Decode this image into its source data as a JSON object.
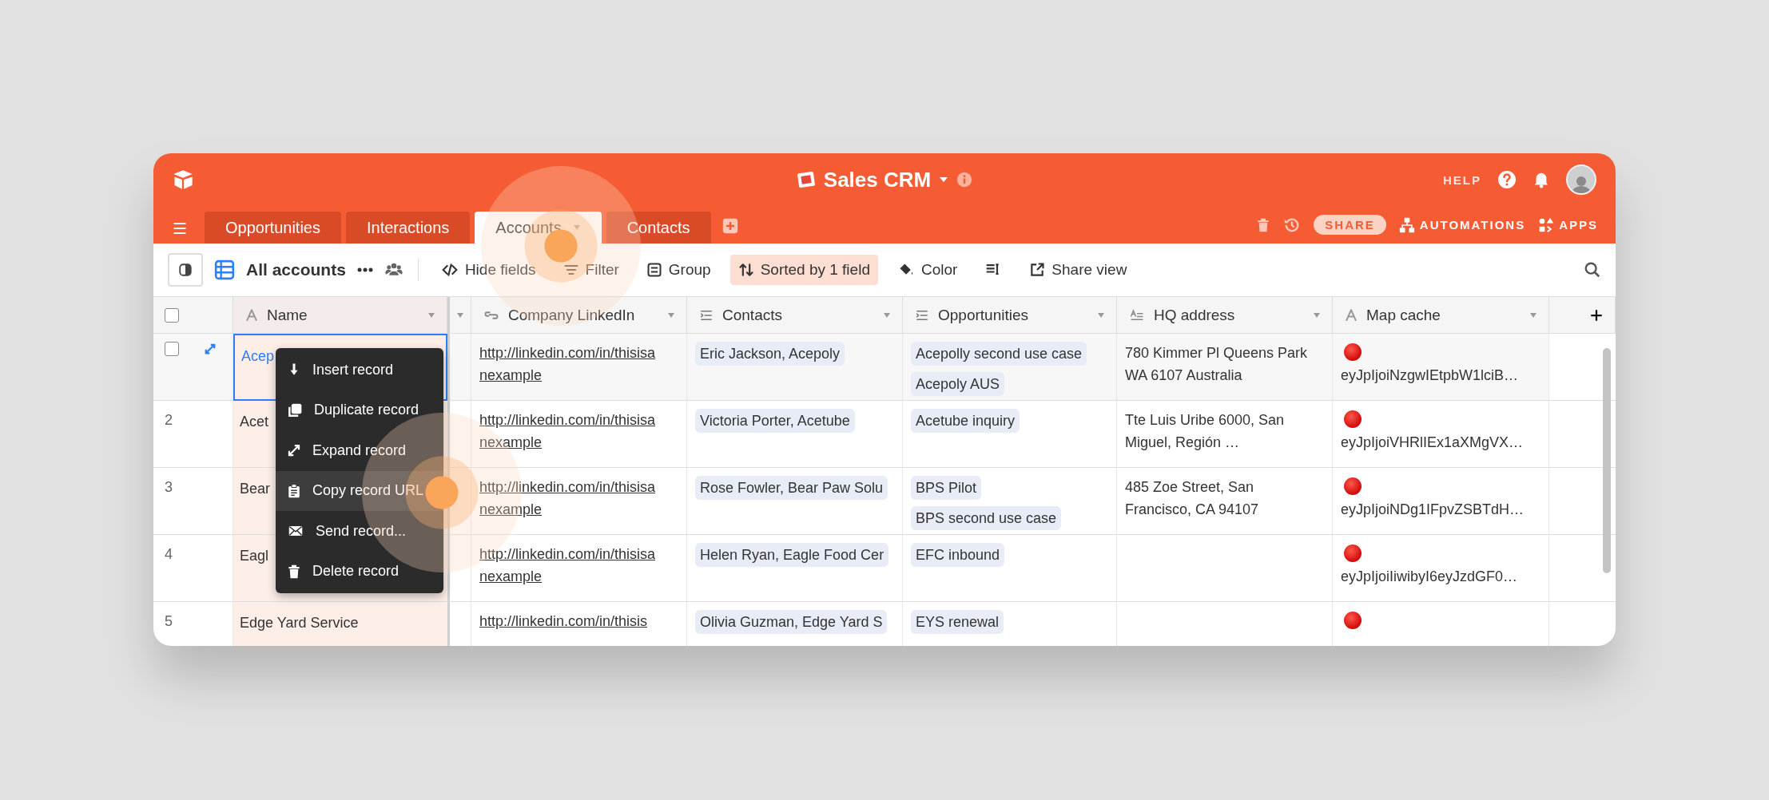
{
  "app": {
    "title": "Sales CRM",
    "help": "HELP"
  },
  "tabs": [
    {
      "label": "Opportunities",
      "selected": false
    },
    {
      "label": "Interactions",
      "selected": false
    },
    {
      "label": "Accounts",
      "selected": true
    },
    {
      "label": "Contacts",
      "selected": false
    }
  ],
  "header_actions": {
    "share": "SHARE",
    "automations": "AUTOMATIONS",
    "apps": "APPS"
  },
  "toolbar": {
    "view_name": "All accounts",
    "buttons": [
      {
        "label": "Hide fields",
        "kind": "hide",
        "active": false
      },
      {
        "label": "Filter",
        "kind": "filter",
        "active": false
      },
      {
        "label": "Group",
        "kind": "group",
        "active": false
      },
      {
        "label": "Sorted by 1 field",
        "kind": "sort",
        "active": true
      },
      {
        "label": "Color",
        "kind": "color",
        "active": false
      },
      {
        "kind": "row-height",
        "active": false
      },
      {
        "label": "Share view",
        "kind": "share",
        "active": false
      }
    ]
  },
  "table": {
    "select_all": {
      "checked": false
    },
    "columns": [
      {
        "label": "Name",
        "kind": "text"
      },
      {
        "kind": "cut"
      },
      {
        "label": "Company LinkedIn",
        "kind": "link"
      },
      {
        "label": "Contacts",
        "kind": "linked"
      },
      {
        "label": "Opportunities",
        "kind": "linked"
      },
      {
        "label": "HQ address",
        "kind": "longtext"
      },
      {
        "label": "Map cache",
        "kind": "text"
      }
    ],
    "rows": [
      {
        "hovered": true,
        "checked": false,
        "selected": true,
        "name": "Acep",
        "linkedin": "http://linkedin.com/in/thisisanexample",
        "contacts": [
          "Eric Jackson, Acepoly"
        ],
        "opportunities": [
          "Acepolly second use case",
          "Acepoly AUS"
        ],
        "hq_address": "780 Kimmer Pl Queens Park WA 6107 Australia",
        "map_cache": "eyJpIjoiNzgwIEtpbW1lciB…"
      },
      {
        "number": "2",
        "hovered": false,
        "selected": false,
        "name": "Acet",
        "linkedin": "http://linkedin.com/in/thisisanexample",
        "contacts": [
          "Victoria Porter, Acetube"
        ],
        "opportunities": [
          "Acetube inquiry"
        ],
        "hq_address": "Tte Luis Uribe 6000, San Miguel, Región …",
        "map_cache": "eyJpIjoiVHRlIEx1aXMgVX…"
      },
      {
        "number": "3",
        "hovered": false,
        "selected": false,
        "name": "Bear",
        "linkedin": "http://linkedin.com/in/thisisanexample",
        "contacts": [
          "Rose Fowler, Bear Paw Solu"
        ],
        "opportunities": [
          "BPS Pilot",
          "BPS second use case"
        ],
        "hq_address": "485 Zoe Street, San Francisco, CA 94107",
        "map_cache": "eyJpIjoiNDg1IFpvZSBTdH…"
      },
      {
        "number": "4",
        "hovered": false,
        "selected": false,
        "name": "Eagl",
        "linkedin": "http://linkedin.com/in/thisisanexample",
        "contacts": [
          "Helen Ryan, Eagle Food Cer"
        ],
        "opportunities": [
          "EFC inbound"
        ],
        "map_cache": "eyJpIjoiIiwibyI6eyJzdGF0…"
      },
      {
        "number": "5",
        "hovered": false,
        "selected": false,
        "name": "Edge Yard Service",
        "linkedin": "http://linkedin.com/in/thisis",
        "contacts": [
          "Olivia Guzman, Edge Yard S"
        ],
        "opportunities": [
          "EYS renewal"
        ]
      }
    ]
  },
  "context_menu": {
    "items": [
      {
        "label": "Insert record",
        "kind": "insert",
        "highlighted": false
      },
      {
        "label": "Duplicate record",
        "kind": "duplicate",
        "highlighted": false
      },
      {
        "label": "Expand record",
        "kind": "expand",
        "highlighted": false
      },
      {
        "label": "Copy record URL",
        "kind": "copy",
        "highlighted": true
      },
      {
        "label": "Send record...",
        "kind": "send",
        "highlighted": false
      },
      {
        "label": "Delete record",
        "kind": "delete",
        "highlighted": false
      }
    ]
  }
}
